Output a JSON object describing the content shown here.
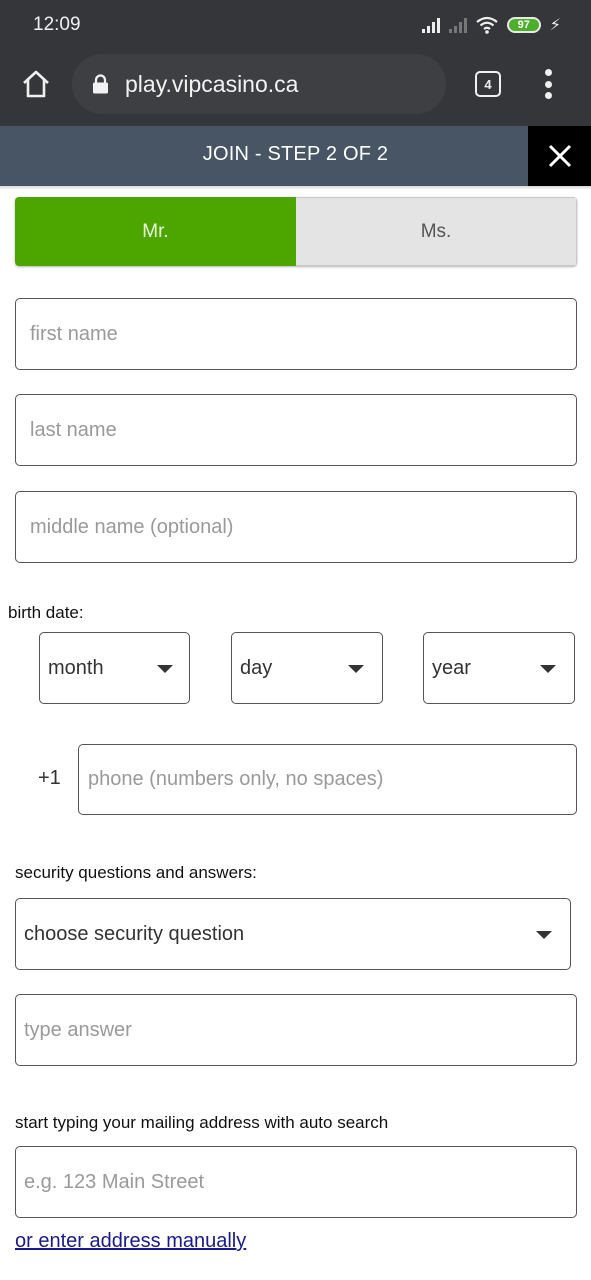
{
  "status_bar": {
    "time": "12:09",
    "battery_percent": "97",
    "icons": [
      "signal-icon",
      "signal-secondary-icon",
      "wifi-icon",
      "battery-icon",
      "charging-icon"
    ]
  },
  "browser": {
    "url": "play.vipcasino.ca",
    "tab_count": "4",
    "icons": [
      "home-icon",
      "lock-icon",
      "tabs-icon",
      "more-vert-icon"
    ]
  },
  "header": {
    "title": "JOIN - STEP 2 OF 2",
    "close_icon": "close-icon"
  },
  "form": {
    "title_options": [
      {
        "label": "Mr.",
        "selected": true
      },
      {
        "label": "Ms.",
        "selected": false
      }
    ],
    "first_name": {
      "value": "",
      "placeholder": "first name"
    },
    "last_name": {
      "value": "",
      "placeholder": "last name"
    },
    "middle_name": {
      "value": "",
      "placeholder": "middle name (optional)"
    },
    "birth_date": {
      "label": "birth date:",
      "month": "month",
      "day": "day",
      "year": "year"
    },
    "phone": {
      "prefix": "+1",
      "value": "",
      "placeholder": "phone (numbers only, no spaces)"
    },
    "security": {
      "label": "security questions and answers:",
      "question": "choose security question",
      "answer": {
        "value": "",
        "placeholder": "type answer"
      }
    },
    "address": {
      "label": "start typing your mailing address with auto search",
      "value": "",
      "placeholder": "e.g. 123 Main Street",
      "manual_link": "or enter address manually"
    }
  },
  "colors": {
    "selected_green": "#4da600",
    "header_bg": "#475564",
    "link_color": "#1a1a8c"
  }
}
